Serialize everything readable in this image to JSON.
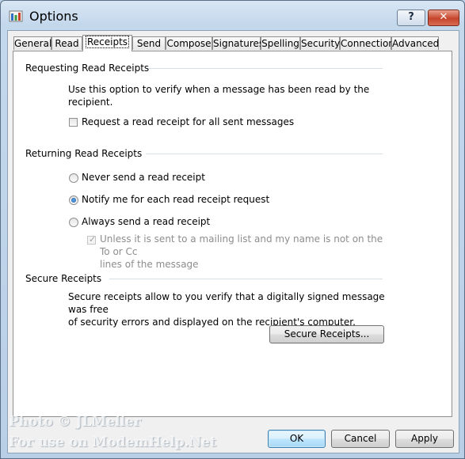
{
  "window": {
    "title": "Options"
  },
  "tabs": [
    "General",
    "Read",
    "Receipts",
    "Send",
    "Compose",
    "Signatures",
    "Spelling",
    "Security",
    "Connection",
    "Advanced"
  ],
  "active_tab": "Receipts",
  "requesting": {
    "heading": "Requesting Read Receipts",
    "description": "Use this option to verify when a message has been read by the recipient.",
    "checkbox_label": "Request a read receipt for all sent messages",
    "checked": false
  },
  "returning": {
    "heading": "Returning Read Receipts",
    "options": [
      {
        "label": "Never send a read receipt",
        "selected": false
      },
      {
        "label": "Notify me for each read receipt request",
        "selected": true
      },
      {
        "label": "Always send a read receipt",
        "selected": false
      }
    ],
    "sub_option": {
      "line1": "Unless it is sent to a mailing list and my name is not on the To or Cc",
      "line2": "lines of the message",
      "checked": true,
      "disabled": true
    }
  },
  "secure": {
    "heading": "Secure Receipts",
    "line1": "Secure receipts allow to you verify that a digitally signed message was free",
    "line2": "of security errors and displayed on the recipient's computer.",
    "button_label": "Secure Receipts..."
  },
  "footer": {
    "ok_label": "OK",
    "cancel_label": "Cancel",
    "apply_label": "Apply"
  },
  "watermark": {
    "line1": "Photo © JLMeller",
    "line2": "For use on ModemHelp.Net"
  },
  "icons": {
    "app": "outlook-express-options-icon",
    "help": "help-icon",
    "close": "close-icon"
  }
}
